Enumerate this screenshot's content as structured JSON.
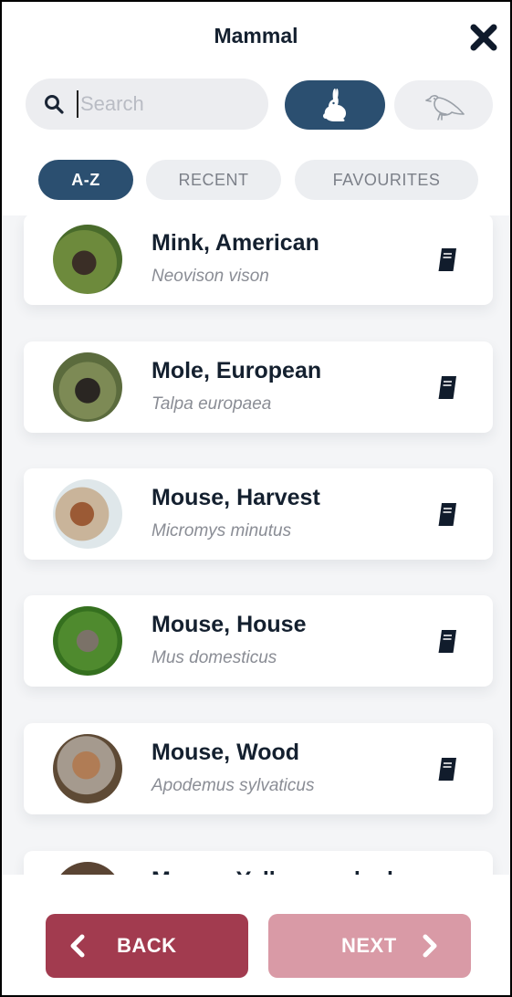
{
  "header": {
    "title": "Mammal"
  },
  "search": {
    "placeholder": "Search"
  },
  "toggles": [
    {
      "name": "mammal",
      "icon": "rabbit-icon",
      "active": true
    },
    {
      "name": "bird",
      "icon": "bird-icon",
      "active": false
    }
  ],
  "tabs": [
    {
      "label": "A-Z",
      "active": true
    },
    {
      "label": "RECENT",
      "active": false
    },
    {
      "label": "FAVOURITES",
      "active": false
    }
  ],
  "species": [
    {
      "common": "Mink, American",
      "latin": "Neovison vison",
      "icon": "book-icon"
    },
    {
      "common": "Mole, European",
      "latin": "Talpa europaea",
      "icon": "book-icon"
    },
    {
      "common": "Mouse, Harvest",
      "latin": "Micromys minutus",
      "icon": "book-icon"
    },
    {
      "common": "Mouse, House",
      "latin": "Mus domesticus",
      "icon": "book-icon"
    },
    {
      "common": "Mouse, Wood",
      "latin": "Apodemus sylvaticus",
      "icon": "book-icon"
    },
    {
      "common": "Mouse, Yellow-necked",
      "latin": "",
      "icon": "book-icon"
    }
  ],
  "buttons": {
    "back": "BACK",
    "next": "NEXT"
  },
  "colors": {
    "primary": "#2b4f70",
    "back": "#a23b4f",
    "next_disabled": "#d99aa6",
    "chip_bg": "#eceef1"
  }
}
